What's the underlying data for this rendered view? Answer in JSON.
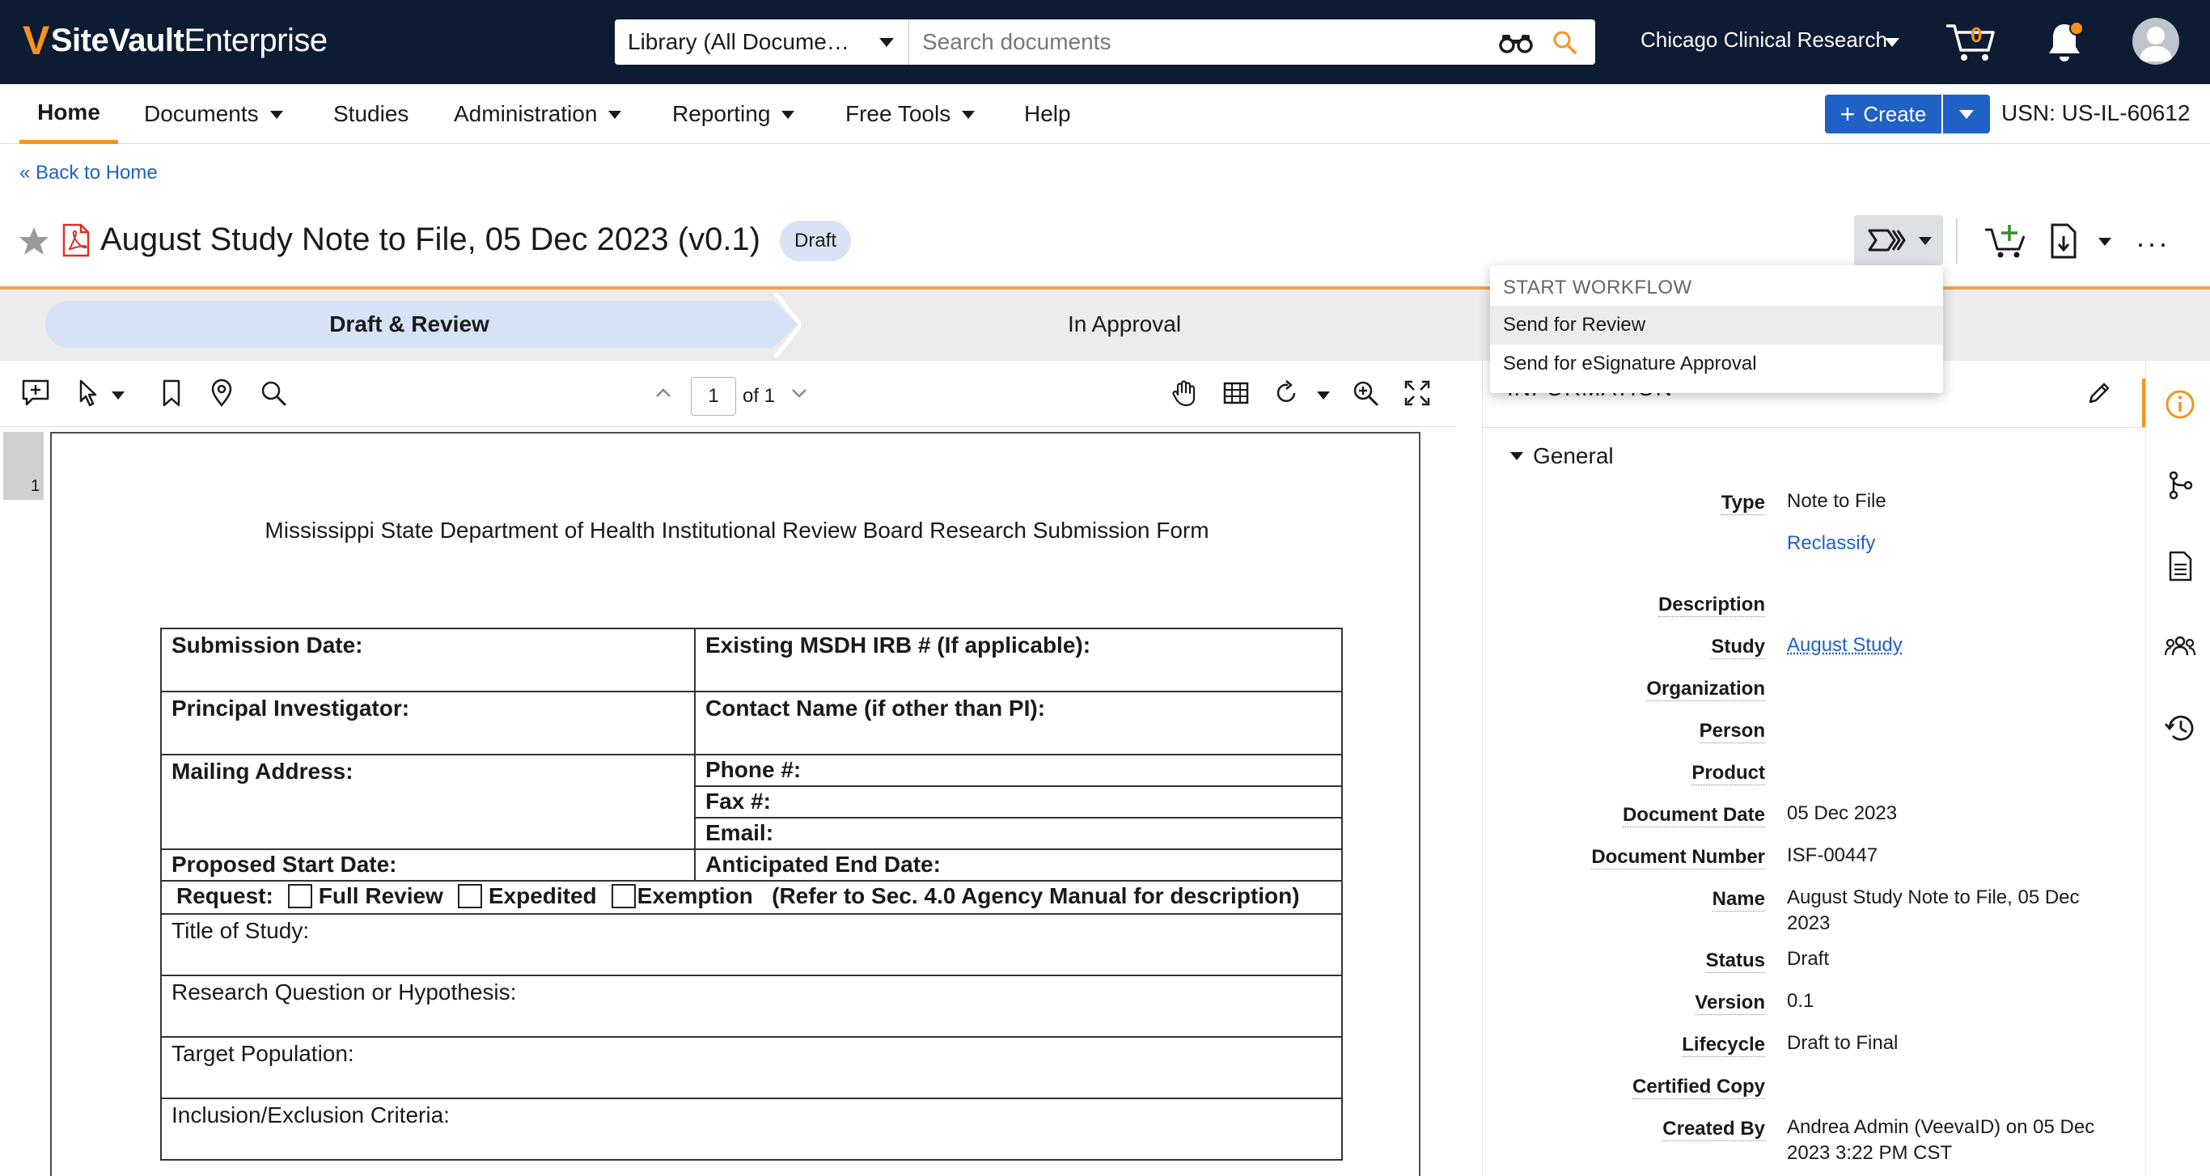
{
  "app": {
    "logo_prefix": "SiteVault",
    "logo_suffix": " Enterprise",
    "vault_name": "Chicago Clinical Research",
    "cart_count": "0"
  },
  "search": {
    "scope": "Library (All Docume…",
    "placeholder": "Search documents"
  },
  "nav": {
    "home": "Home",
    "documents": "Documents",
    "studies": "Studies",
    "administration": "Administration",
    "reporting": "Reporting",
    "free_tools": "Free Tools",
    "help": "Help",
    "create": "Create",
    "usn": "USN: US-IL-60612"
  },
  "page": {
    "back_link": "« Back to Home",
    "title": "August Study Note to File, 05 Dec 2023 (v0.1)",
    "status": "Draft",
    "more": "···"
  },
  "lifecycle": {
    "stages": [
      "Draft & Review",
      "In Approval"
    ],
    "active": "Draft & Review"
  },
  "viewer": {
    "page_value": "1",
    "page_of": "of 1",
    "thumb_num": "1"
  },
  "document": {
    "form_title": "Mississippi State Department of Health Institutional Review Board Research Submission Form",
    "submission_date": "Submission Date:",
    "existing_irb": "Existing MSDH IRB # (If applicable):",
    "pi": "Principal Investigator:",
    "contact_name": "Contact Name (if other than PI):",
    "mailing_address": "Mailing Address:",
    "phone": "Phone #:",
    "fax": "Fax #:",
    "email": "Email:",
    "start_date": "Proposed Start Date:",
    "end_date": "Anticipated End Date:",
    "request": "Request:",
    "full_review": "Full Review",
    "expedited": "Expedited",
    "exemption": "Exemption",
    "refer": "(Refer to Sec. 4.0 Agency Manual for description)",
    "title_of_study": "Title of Study:",
    "research_question": "Research Question or Hypothesis:",
    "target_population": "Target Population:",
    "inclusion_exclusion": "Inclusion/Exclusion Criteria:"
  },
  "info": {
    "header": "INFORMATION",
    "section": "General",
    "type_label": "Type",
    "type_value": "Note to File",
    "reclassify": "Reclassify",
    "description_label": "Description",
    "study_label": "Study",
    "study_value": "August Study",
    "organization_label": "Organization",
    "person_label": "Person",
    "product_label": "Product",
    "document_date_label": "Document Date",
    "document_date_value": "05 Dec 2023",
    "document_number_label": "Document Number",
    "document_number_value": "ISF-00447",
    "name_label": "Name",
    "name_value": "August Study Note to File, 05 Dec 2023",
    "status_label": "Status",
    "status_value": "Draft",
    "version_label": "Version",
    "version_value": "0.1",
    "lifecycle_label": "Lifecycle",
    "lifecycle_value": "Draft to Final",
    "certified_copy_label": "Certified Copy",
    "created_by_label": "Created By",
    "created_by_value": "Andrea Admin (VeevaID) on 05 Dec 2023 3:22 PM CST"
  },
  "workflow_menu": {
    "header": "START WORKFLOW",
    "items": [
      "Send for Review",
      "Send for eSignature Approval"
    ]
  },
  "colors": {
    "topbar": "#0d1b33",
    "accent": "#f7931e",
    "link": "#1f61c4",
    "active_stage": "#d6e2f5"
  }
}
